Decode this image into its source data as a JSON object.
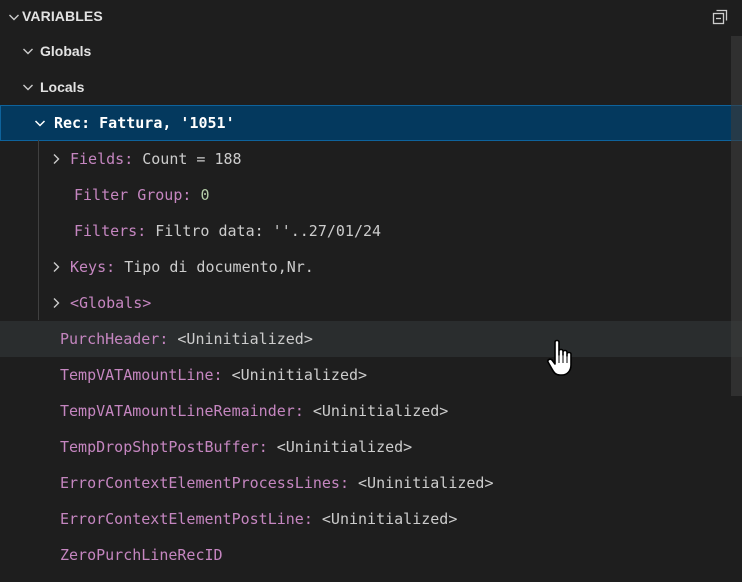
{
  "section": {
    "title": "VARIABLES",
    "collapse_icon": "collapse-all-icon"
  },
  "scopes": {
    "globals": "Globals",
    "locals": "Locals"
  },
  "rec": {
    "name": "Rec",
    "separator": ":",
    "value": "Fattura, '1051'"
  },
  "rec_children": {
    "fields_name": "Fields",
    "fields_value": "Count = 188",
    "filter_group_name": "Filter Group",
    "filter_group_value": "0",
    "filters_name": "Filters",
    "filters_value": "Filtro data: ''..27/01/24",
    "keys_name": "Keys",
    "keys_value": "Tipo di documento,Nr.",
    "globals_name": "<Globals>"
  },
  "locals": [
    {
      "name": "PurchHeader",
      "value": "<Uninitialized>"
    },
    {
      "name": "TempVATAmountLine",
      "value": "<Uninitialized>"
    },
    {
      "name": "TempVATAmountLineRemainder",
      "value": "<Uninitialized>"
    },
    {
      "name": "TempDropShptPostBuffer",
      "value": "<Uninitialized>"
    },
    {
      "name": "ErrorContextElementProcessLines",
      "value": "<Uninitialized>"
    },
    {
      "name": "ErrorContextElementPostLine",
      "value": "<Uninitialized>"
    },
    {
      "name": "ZeroPurchLineRecID",
      "value": ""
    }
  ],
  "colors": {
    "background": "#1e1e1e",
    "variable_name": "#c586c0",
    "value_text": "#cccccc",
    "number_value": "#b5cea8",
    "selection_background": "#04395e",
    "selection_border": "#0e639c"
  }
}
